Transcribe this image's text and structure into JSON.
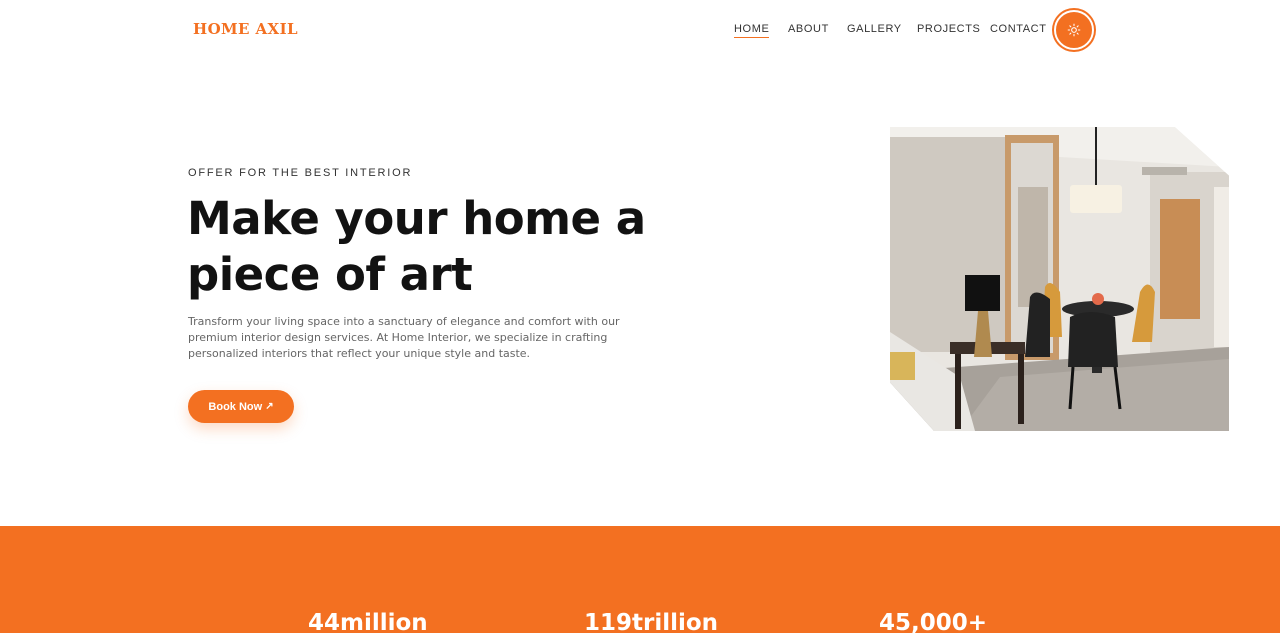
{
  "brand": {
    "name": "HOME AXIL",
    "accent_color": "#f37021"
  },
  "nav": {
    "items": [
      {
        "label": "HOME",
        "active": true
      },
      {
        "label": "ABOUT",
        "active": false
      },
      {
        "label": "GALLERY",
        "active": false
      },
      {
        "label": "PROJECTS",
        "active": false
      },
      {
        "label": "CONTACT",
        "active": false
      }
    ],
    "theme_toggle_icon": "sun-icon"
  },
  "hero": {
    "eyebrow": "OFFER FOR THE BEST INTERIOR",
    "title": "Make your home a piece of art",
    "description": "Transform your living space into a sanctuary of elegance and comfort with our premium interior design services. At Home Interior, we specialize in crafting personalized interiors that reflect your unique style and taste.",
    "cta_label": "Book Now",
    "cta_icon": "arrow-up-right-icon"
  },
  "stats": [
    {
      "value": "44million"
    },
    {
      "value": "119trillion"
    },
    {
      "value": "45,000+"
    }
  ]
}
